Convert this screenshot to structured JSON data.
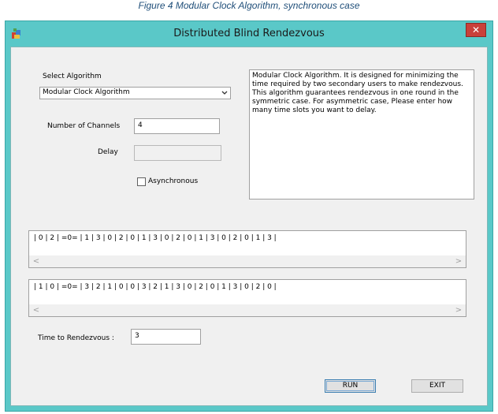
{
  "caption": "Figure 4 Modular Clock Algorithm, synchronous case",
  "window": {
    "title": "Distributed Blind Rendezvous",
    "close_label": "✕"
  },
  "form": {
    "select_label": "Select Algorithm",
    "algorithm_value": "Modular Clock Algorithm",
    "channels_label": "Number of Channels",
    "channels_value": "4",
    "delay_label": "Delay",
    "delay_value": "",
    "async_label": "Asynchronous",
    "async_checked": false,
    "description": "Modular Clock Algorithm. It is designed for minimizing the time required by two secondary users to make rendezvous. This algorithm guarantees rendezvous in one round in the symmetric case. For asymmetric case, Please enter how many time slots you want to delay.",
    "sequence1": "| 0 | 2 | =0= | 1 | 3 | 0 | 2 | 0 | 1 | 3 | 0 | 2 | 0 | 1 | 3 | 0 | 2 | 0 | 1 | 3 |",
    "sequence2": "| 1 | 0 | =0= | 3 | 2 | 1 | 0 | 0 | 3 | 2 | 1 | 3 | 0 | 2 | 0 | 1 | 3 | 0 | 2 | 0 |",
    "rendezvous_label": "Time to Rendezvous :",
    "rendezvous_value": "3"
  },
  "buttons": {
    "run": "RUN",
    "exit": "EXIT"
  },
  "scroll": {
    "left_arrow": "<",
    "right_arrow": ">"
  }
}
